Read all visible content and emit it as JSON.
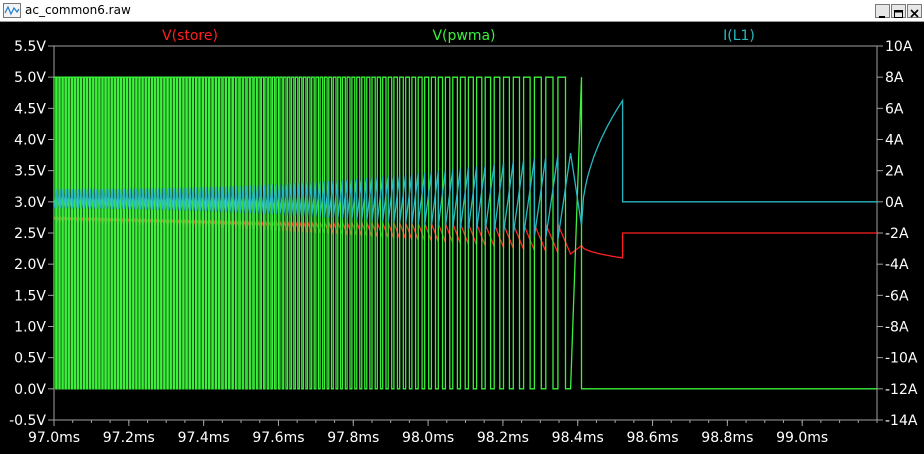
{
  "window": {
    "title": "ac_common6.raw",
    "buttons": {
      "minimize": "minimize-icon",
      "maximize": "maximize-icon",
      "close": "close-icon"
    }
  },
  "colors": {
    "store": "#ff2020",
    "pwma": "#3cf03c",
    "i_l1": "#28b8c0",
    "axis": "#a0a0a0",
    "tick_text": "#ffffff",
    "background": "#000000"
  },
  "chart_data": {
    "type": "line",
    "title": "",
    "x_axis": {
      "unit": "ms",
      "range": [
        97.0,
        99.2
      ],
      "ticks": [
        97.0,
        97.2,
        97.4,
        97.6,
        97.8,
        98.0,
        98.2,
        98.4,
        98.6,
        98.8,
        99.0
      ],
      "tick_labels": [
        "97.0ms",
        "97.2ms",
        "97.4ms",
        "97.6ms",
        "97.8ms",
        "98.0ms",
        "98.2ms",
        "98.4ms",
        "98.6ms",
        "98.8ms",
        "99.0ms"
      ]
    },
    "y_left": {
      "unit": "V",
      "range": [
        -0.5,
        5.5
      ],
      "ticks": [
        5.5,
        5.0,
        4.5,
        4.0,
        3.5,
        3.0,
        2.5,
        2.0,
        1.5,
        1.0,
        0.5,
        0.0,
        -0.5
      ],
      "tick_labels": [
        "5.5V",
        "5.0V",
        "4.5V",
        "4.0V",
        "3.5V",
        "3.0V",
        "2.5V",
        "2.0V",
        "1.5V",
        "1.0V",
        "0.5V",
        "0.0V",
        "-0.5V"
      ]
    },
    "y_right": {
      "unit": "A",
      "range": [
        -14,
        10
      ],
      "ticks": [
        10,
        8,
        6,
        4,
        2,
        0,
        -2,
        -4,
        -6,
        -8,
        -10,
        -12,
        -14
      ],
      "tick_labels": [
        "10A",
        "8A",
        "6A",
        "4A",
        "2A",
        "0A",
        "-2A",
        "-4A",
        "-6A",
        "-8A",
        "-10A",
        "-12A",
        "-14A"
      ]
    },
    "series": [
      {
        "name": "V(store)",
        "axis": "left",
        "color": "#ff2020",
        "description_points": {
          "t_ms": [
            97.0,
            98.0,
            98.4,
            98.52,
            99.2
          ],
          "v": [
            2.8,
            2.65,
            2.3,
            2.5,
            2.5
          ]
        }
      },
      {
        "name": "V(pwma)",
        "axis": "left",
        "color": "#3cf03c",
        "low": 0.0,
        "high": 5.0,
        "pwm_start_ms": 97.0,
        "pwm_end_ms": 98.41
      },
      {
        "name": "I(L1)",
        "axis": "right",
        "color": "#28b8c0",
        "peak_A": 6.5,
        "final_A": 0.0
      }
    ],
    "legend": [
      "V(store)",
      "V(pwma)",
      "I(L1)"
    ],
    "grid": false
  }
}
